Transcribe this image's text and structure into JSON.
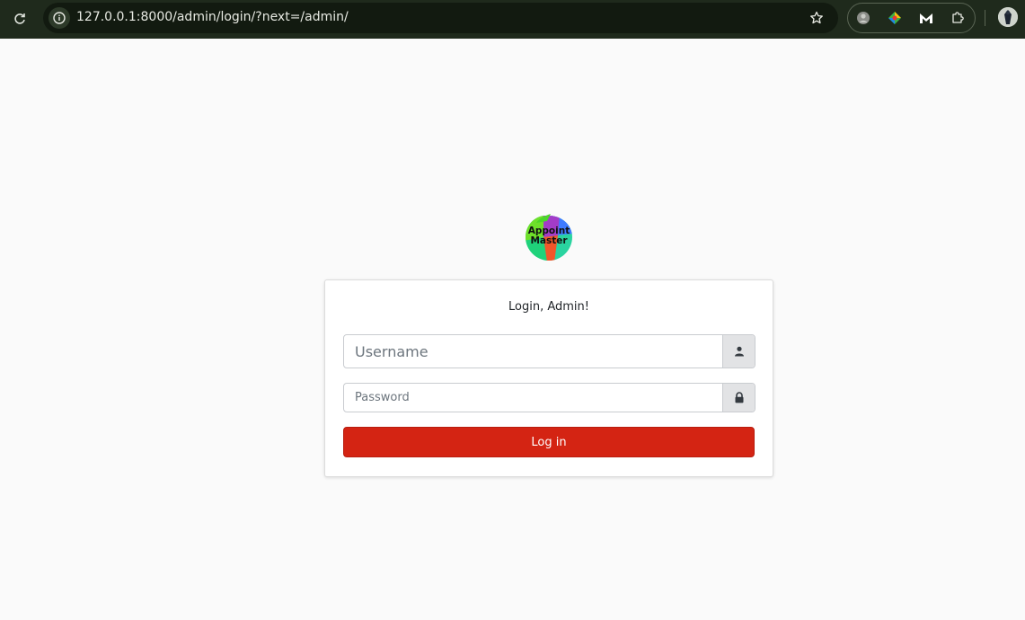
{
  "browser": {
    "url": "127.0.0.1:8000/admin/login/?next=/admin/",
    "icons": [
      "reload-icon",
      "site-info-icon",
      "bookmark-star-icon",
      "extension-puzzle-icon",
      "profile-avatar"
    ]
  },
  "logo": {
    "line1": "Appoint",
    "line2": "Master"
  },
  "login": {
    "message": "Login, Admin!",
    "username_placeholder": "Username",
    "username_value": "",
    "password_placeholder": "Password",
    "password_value": "",
    "submit_label": "Log in"
  },
  "colors": {
    "primary_button": "#d42413",
    "page_background": "#fafafa",
    "browser_bar": "#1f2a1c"
  }
}
